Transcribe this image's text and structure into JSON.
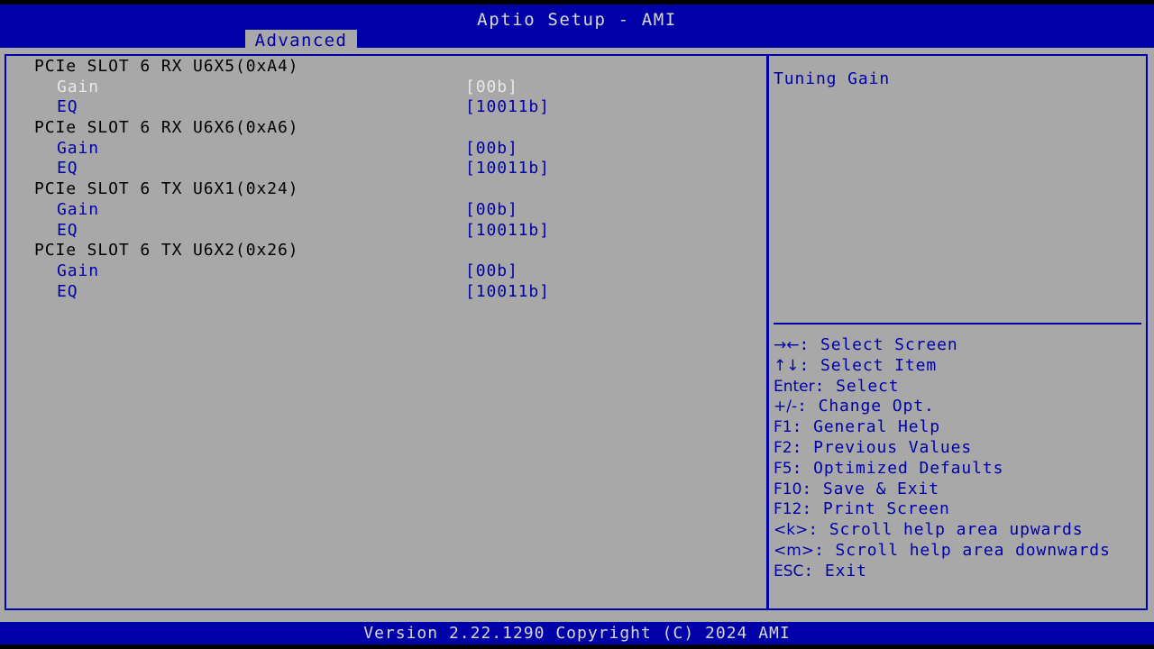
{
  "header": {
    "title": "Aptio Setup - AMI",
    "active_tab": "Advanced",
    "tabs": [
      "Advanced"
    ]
  },
  "colors": {
    "blue": "#0000a8",
    "gray": "#a8a8a8",
    "black": "#000000",
    "selected_text": "#e8e8e8",
    "header_text": "#d8d8d8"
  },
  "main": {
    "groups": [
      {
        "title": "PCIe SLOT 6 RX U6X5(0xA4)",
        "items": [
          {
            "label": "Gain",
            "value": "[00b]",
            "selected": true
          },
          {
            "label": "EQ",
            "value": "[10011b]",
            "selected": false
          }
        ]
      },
      {
        "title": "PCIe SLOT 6 RX U6X6(0xA6)",
        "items": [
          {
            "label": "Gain",
            "value": "[00b]",
            "selected": false
          },
          {
            "label": "EQ",
            "value": "[10011b]",
            "selected": false
          }
        ]
      },
      {
        "title": "PCIe SLOT 6 TX U6X1(0x24)",
        "items": [
          {
            "label": "Gain",
            "value": "[00b]",
            "selected": false
          },
          {
            "label": "EQ",
            "value": "[10011b]",
            "selected": false
          }
        ]
      },
      {
        "title": "PCIe SLOT 6 TX U6X2(0x26)",
        "items": [
          {
            "label": "Gain",
            "value": "[00b]",
            "selected": false
          },
          {
            "label": "EQ",
            "value": "[10011b]",
            "selected": false
          }
        ]
      }
    ]
  },
  "help": {
    "description": "Tuning Gain",
    "legend": [
      {
        "keys": "→←",
        "icon": "arrow-left-right-icon",
        "text": ": Select Screen"
      },
      {
        "keys": "↑↓",
        "icon": "arrow-up-down-icon",
        "text": ": Select Item"
      },
      {
        "keys": "Enter",
        "icon": "enter-key-icon",
        "text": ": Select"
      },
      {
        "keys": "+/-",
        "icon": "plus-minus-key-icon",
        "text": ": Change Opt."
      },
      {
        "keys": "F1",
        "icon": "f1-key-icon",
        "text": ": General Help"
      },
      {
        "keys": "F2",
        "icon": "f2-key-icon",
        "text": ": Previous Values"
      },
      {
        "keys": "F5",
        "icon": "f5-key-icon",
        "text": ": Optimized Defaults"
      },
      {
        "keys": "F10",
        "icon": "f10-key-icon",
        "text": ": Save & Exit"
      },
      {
        "keys": "F12",
        "icon": "f12-key-icon",
        "text": ": Print Screen"
      },
      {
        "keys": "<k>",
        "icon": "k-key-icon",
        "text": ": Scroll help area upwards"
      },
      {
        "keys": "<m>",
        "icon": "m-key-icon",
        "text": ": Scroll help area downwards"
      },
      {
        "keys": "ESC",
        "icon": "esc-key-icon",
        "text": ": Exit"
      }
    ]
  },
  "footer": {
    "version_text": "Version 2.22.1290 Copyright (C) 2024 AMI"
  }
}
